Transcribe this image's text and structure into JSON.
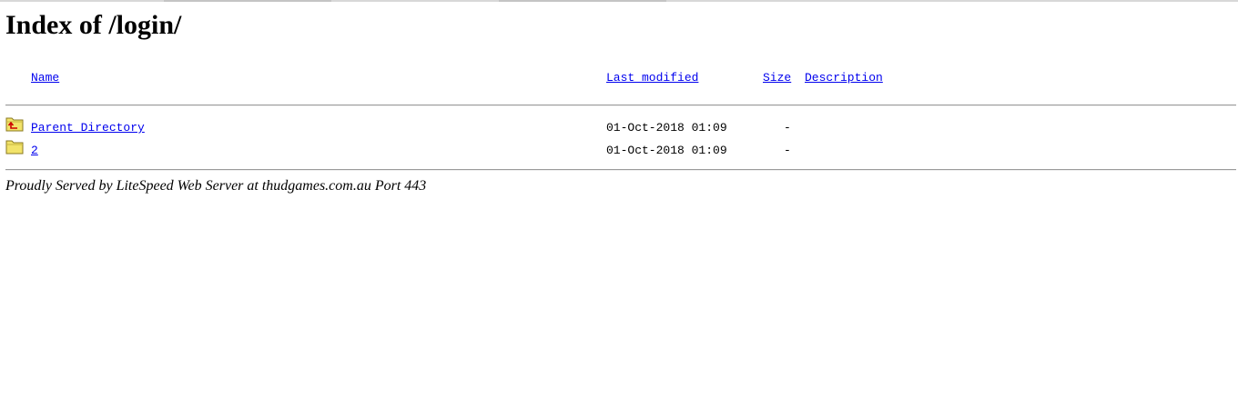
{
  "page": {
    "title": "Index of /login/"
  },
  "listing": {
    "headers": {
      "name": "Name",
      "last_modified": "Last modified",
      "size": "Size",
      "description": "Description"
    },
    "rows": [
      {
        "icon": "parent-directory-icon",
        "name": "Parent Directory",
        "last_modified": "01-Oct-2018 01:09",
        "size": "-",
        "description": ""
      },
      {
        "icon": "folder-icon",
        "name": "2",
        "last_modified": "01-Oct-2018 01:09",
        "size": "-",
        "description": ""
      }
    ]
  },
  "footer": {
    "text": "Proudly Served by LiteSpeed Web Server at thudgames.com.au Port 443"
  },
  "colors": {
    "link": "#0000ee",
    "folder": "#f2e36a",
    "folder_outline": "#8a7a20",
    "parent_arrow": "#cc0000"
  }
}
